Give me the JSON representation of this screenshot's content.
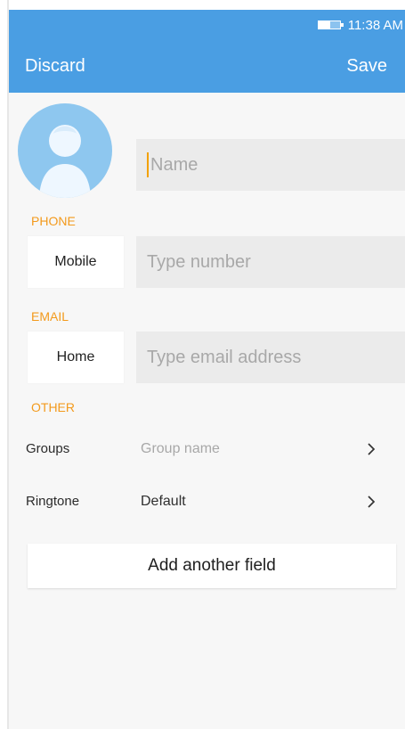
{
  "status_bar": {
    "time": "11:38 AM",
    "battery_icon": "battery-icon",
    "battery_level": 0.55
  },
  "header": {
    "discard_label": "Discard",
    "save_label": "Save",
    "background": "#4a9ee3"
  },
  "profile": {
    "avatar_icon": "person-avatar-icon",
    "name_placeholder": "Name"
  },
  "sections": {
    "phone": {
      "label": "PHONE",
      "type": "Mobile",
      "placeholder": "Type number"
    },
    "email": {
      "label": "EMAIL",
      "type": "Home",
      "placeholder": "Type email address"
    },
    "other": {
      "label": "OTHER",
      "groups_label": "Groups",
      "groups_value": "Group name",
      "ringtone_label": "Ringtone",
      "ringtone_value": "Default",
      "chevron_icon": "chevron-right-icon"
    }
  },
  "actions": {
    "add_field_label": "Add another field"
  },
  "colors": {
    "accent": "#f39a1c",
    "header": "#4a9ee3",
    "field_background": "#ebebeb"
  }
}
